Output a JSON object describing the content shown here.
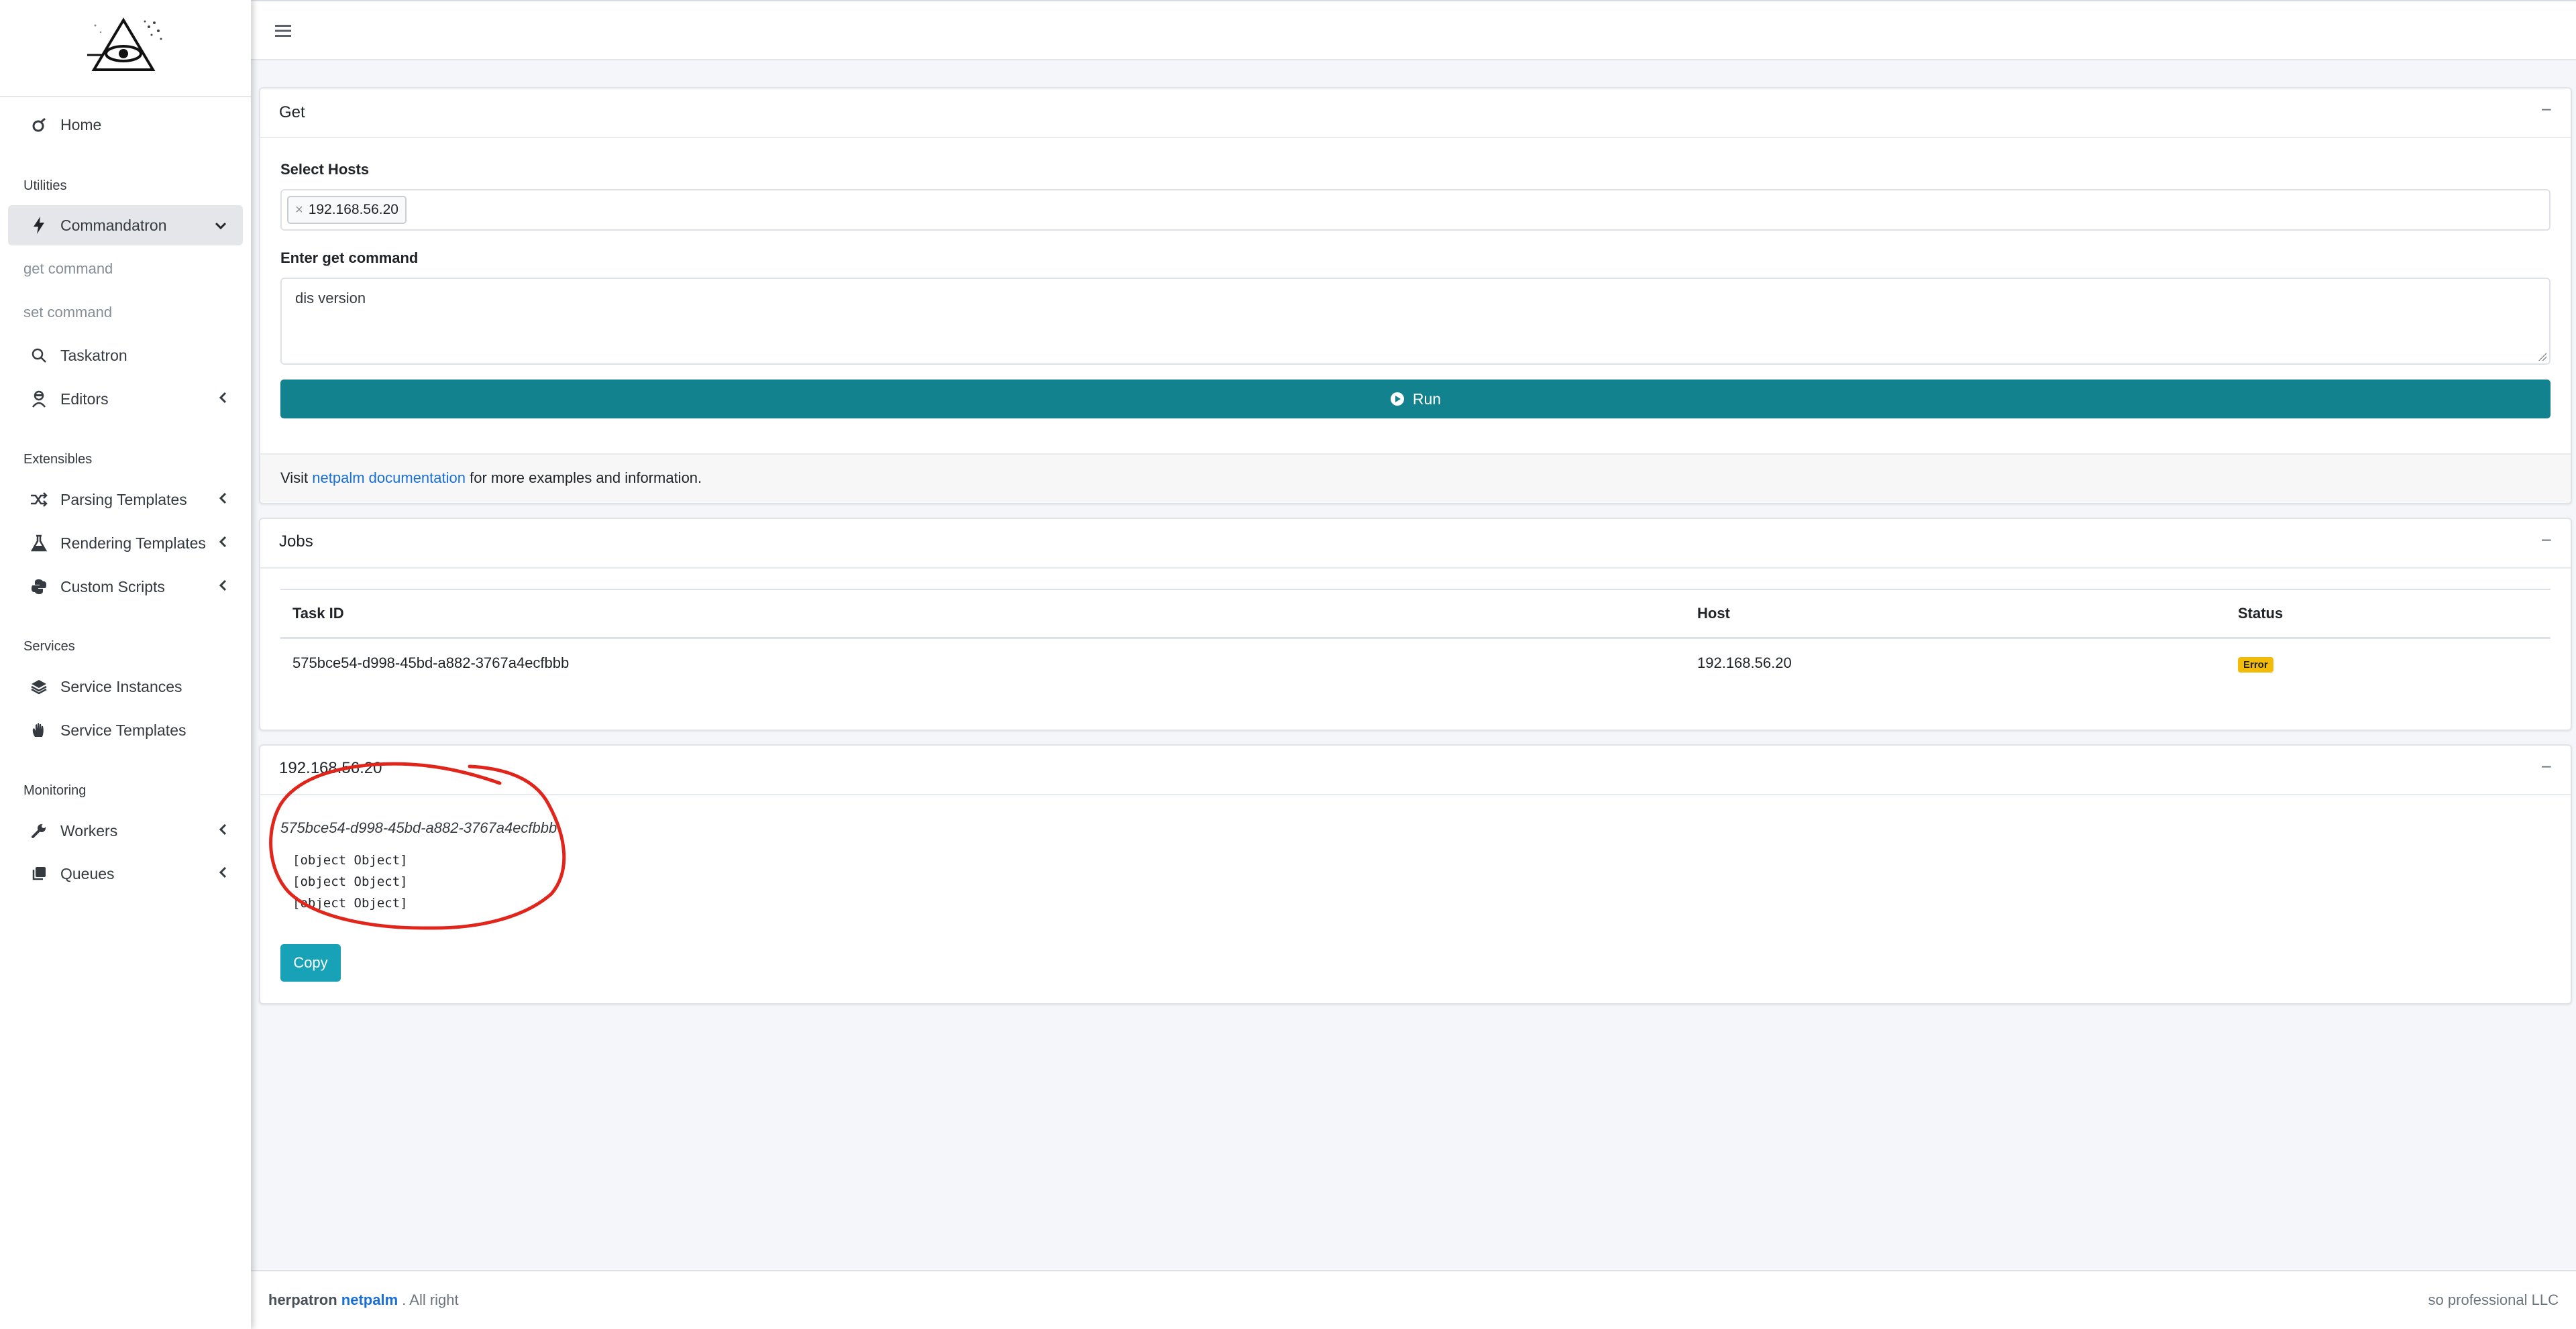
{
  "sidebar": {
    "home": "Home",
    "utilities_header": "Utilities",
    "commandatron": "Commandatron",
    "get_command": "get command",
    "set_command": "set command",
    "taskatron": "Taskatron",
    "editors": "Editors",
    "extensibles_header": "Extensibles",
    "parsing_templates": "Parsing Templates",
    "rendering_templates": "Rendering Templates",
    "custom_scripts": "Custom Scripts",
    "services_header": "Services",
    "service_instances": "Service Instances",
    "service_templates": "Service Templates",
    "monitoring_header": "Monitoring",
    "workers": "Workers",
    "queues": "Queues"
  },
  "topbar": {
    "menu_icon": "hamburger-icon"
  },
  "get_card": {
    "title": "Get",
    "collapse": "−",
    "select_hosts_label": "Select Hosts",
    "chip_remove": "×",
    "selected_host": "192.168.56.20",
    "command_label": "Enter get command",
    "command_value": "dis version",
    "run_label": "Run",
    "footer_prefix": "Visit ",
    "footer_link": "netpalm documentation",
    "footer_suffix": " for more examples and information."
  },
  "jobs_card": {
    "title": "Jobs",
    "collapse": "−",
    "headers": {
      "task_id": "Task ID",
      "host": "Host",
      "status": "Status"
    },
    "rows": [
      {
        "task_id": "575bce54-d998-45bd-a882-3767a4ecfbbb",
        "host": "192.168.56.20",
        "status": "Error"
      }
    ]
  },
  "result_card": {
    "title": "192.168.56.20",
    "collapse": "−",
    "task_id": "575bce54-d998-45bd-a882-3767a4ecfbbb",
    "output_lines": [
      "[object Object]",
      "[object Object]",
      "[object Object]"
    ],
    "copy_label": "Copy"
  },
  "footer": {
    "left_prefix": "herpatron ",
    "left_brand": "netpalm",
    "left_suffix": " . All right",
    "right": "so professional LLC"
  },
  "colors": {
    "accent_teal": "#13828f",
    "copy_button": "#17a2b8",
    "error_badge": "#f2bb07",
    "link": "#1a6fd6",
    "annotation_red": "#e1251b"
  }
}
